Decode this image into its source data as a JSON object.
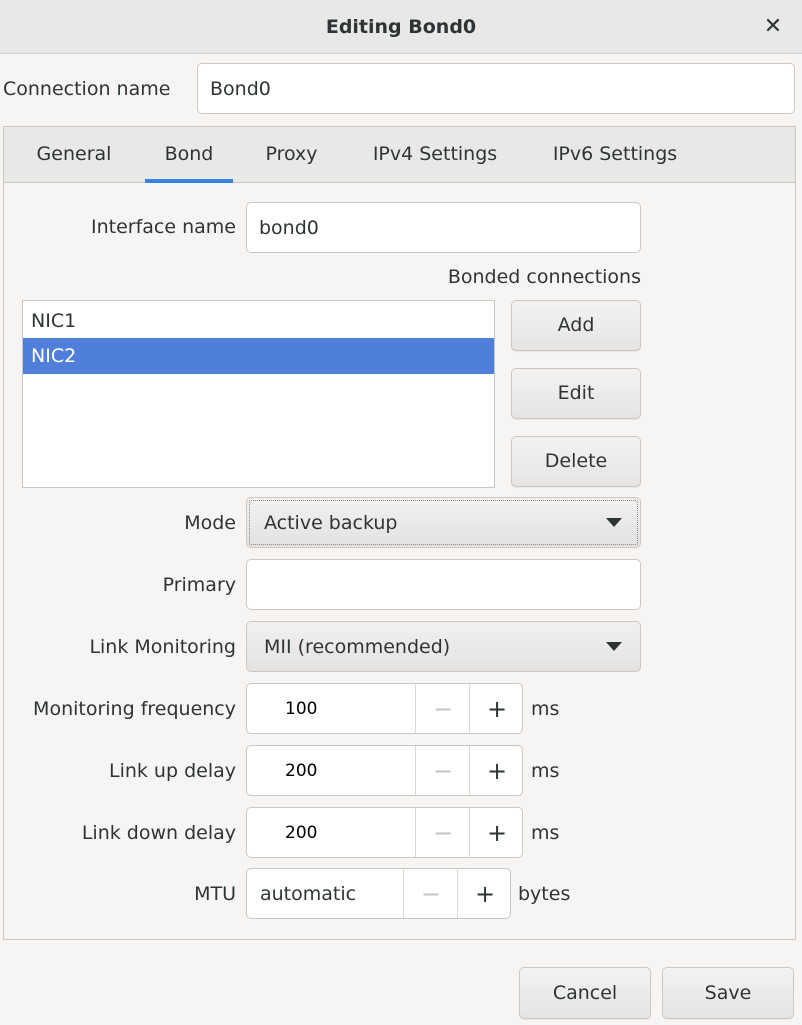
{
  "window": {
    "title": "Editing Bond0",
    "close_glyph": "✕"
  },
  "connection": {
    "label": "Connection name",
    "value": "Bond0"
  },
  "tabs": [
    {
      "label": "General"
    },
    {
      "label": "Bond"
    },
    {
      "label": "Proxy"
    },
    {
      "label": "IPv4 Settings"
    },
    {
      "label": "IPv6 Settings"
    }
  ],
  "bond": {
    "interface_label": "Interface name",
    "interface_value": "bond0",
    "bonded_label": "Bonded connections",
    "bonded": [
      {
        "name": "NIC1"
      },
      {
        "name": "NIC2"
      }
    ],
    "buttons": {
      "add": "Add",
      "edit": "Edit",
      "delete": "Delete"
    },
    "mode": {
      "label": "Mode",
      "value": "Active backup"
    },
    "primary": {
      "label": "Primary",
      "value": ""
    },
    "link_monitoring": {
      "label": "Link Monitoring",
      "value": "MII (recommended)"
    },
    "monitoring_frequency": {
      "label": "Monitoring frequency",
      "value": "100",
      "unit": "ms"
    },
    "link_up_delay": {
      "label": "Link up delay",
      "value": "200",
      "unit": "ms"
    },
    "link_down_delay": {
      "label": "Link down delay",
      "value": "200",
      "unit": "ms"
    },
    "mtu": {
      "label": "MTU",
      "value": "automatic",
      "unit": "bytes"
    },
    "spin_minus": "−",
    "spin_plus": "+"
  },
  "footer": {
    "cancel": "Cancel",
    "save": "Save"
  },
  "colors": {
    "accent": "#3584e4",
    "selection": "#4f7fd8"
  }
}
